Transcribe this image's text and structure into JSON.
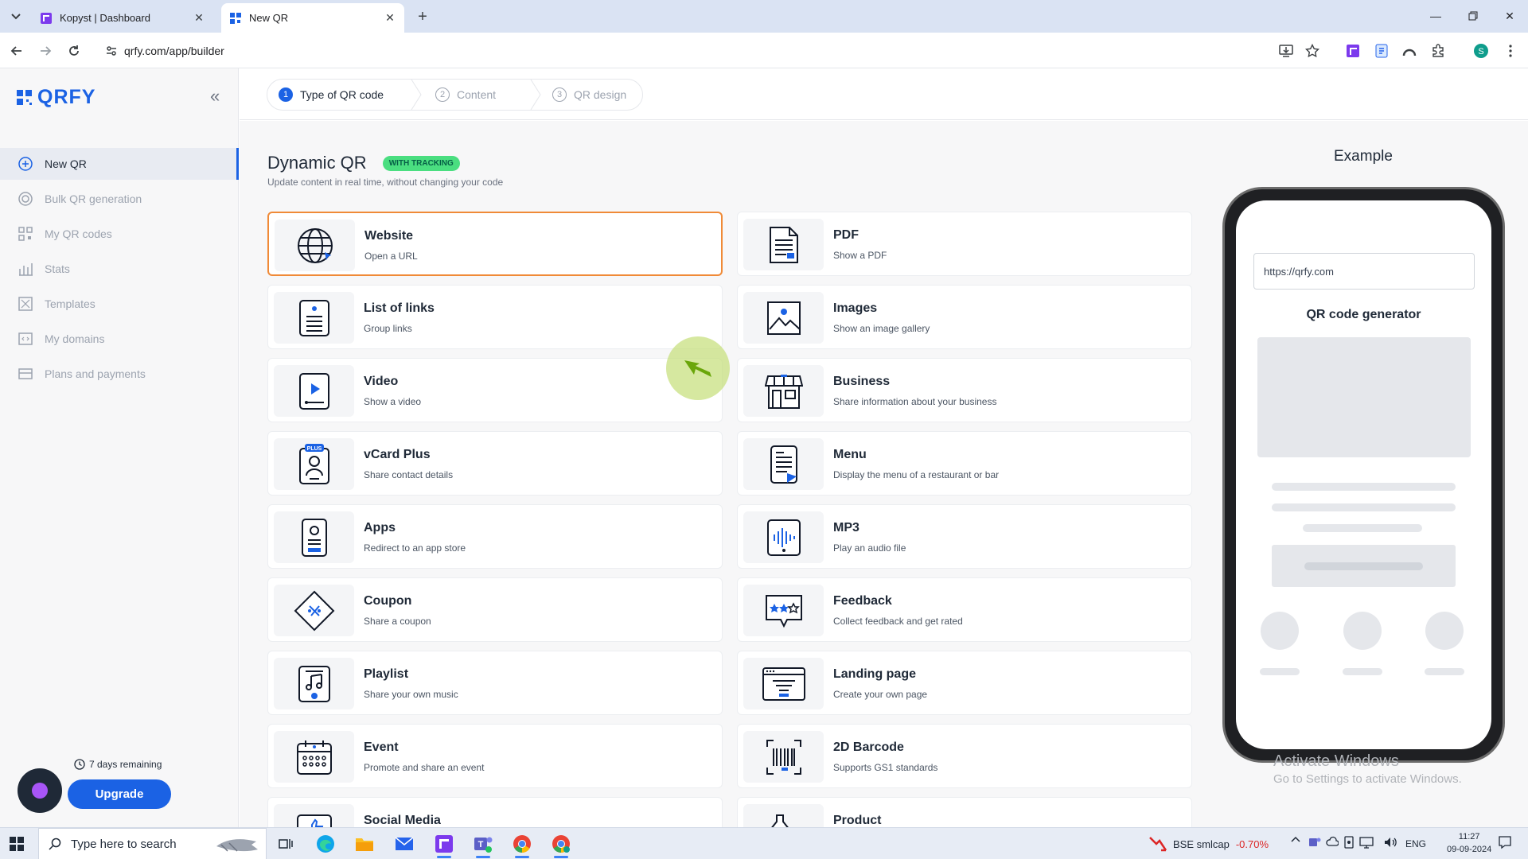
{
  "browser": {
    "tabs": [
      {
        "title": "Kopyst | Dashboard",
        "active": false
      },
      {
        "title": "New QR",
        "active": true
      }
    ],
    "url": "qrfy.com/app/builder"
  },
  "sidebar": {
    "logo": "QRFY",
    "items": [
      {
        "label": "New QR",
        "icon": "plus-circle-icon",
        "active": true
      },
      {
        "label": "Bulk QR generation",
        "icon": "target-icon",
        "active": false
      },
      {
        "label": "My QR codes",
        "icon": "qr-grid-icon",
        "active": false
      },
      {
        "label": "Stats",
        "icon": "bar-chart-icon",
        "active": false
      },
      {
        "label": "Templates",
        "icon": "template-icon",
        "active": false
      },
      {
        "label": "My domains",
        "icon": "domain-icon",
        "active": false
      },
      {
        "label": "Plans and payments",
        "icon": "card-icon",
        "active": false
      }
    ],
    "trial": "7 days remaining",
    "upgrade": "Upgrade"
  },
  "steps": [
    {
      "num": "1",
      "label": "Type of QR code",
      "active": true
    },
    {
      "num": "2",
      "label": "Content",
      "active": false
    },
    {
      "num": "3",
      "label": "QR design",
      "active": false
    }
  ],
  "heading": {
    "title": "Dynamic QR",
    "badge": "WITH TRACKING",
    "subtitle": "Update content in real time, without changing your code"
  },
  "cards": [
    {
      "title": "Website",
      "desc": "Open a URL",
      "icon": "globe-icon",
      "selected": true
    },
    {
      "title": "PDF",
      "desc": "Show a PDF",
      "icon": "pdf-icon"
    },
    {
      "title": "List of links",
      "desc": "Group links",
      "icon": "links-list-icon"
    },
    {
      "title": "Images",
      "desc": "Show an image gallery",
      "icon": "image-icon"
    },
    {
      "title": "Video",
      "desc": "Show a video",
      "icon": "video-icon"
    },
    {
      "title": "Business",
      "desc": "Share information about your business",
      "icon": "store-icon"
    },
    {
      "title": "vCard Plus",
      "desc": "Share contact details",
      "icon": "vcard-icon",
      "tag": "PLUS"
    },
    {
      "title": "Menu",
      "desc": "Display the menu of a restaurant or bar",
      "icon": "menu-icon"
    },
    {
      "title": "Apps",
      "desc": "Redirect to an app store",
      "icon": "app-icon"
    },
    {
      "title": "MP3",
      "desc": "Play an audio file",
      "icon": "audio-icon"
    },
    {
      "title": "Coupon",
      "desc": "Share a coupon",
      "icon": "coupon-icon"
    },
    {
      "title": "Feedback",
      "desc": "Collect feedback and get rated",
      "icon": "feedback-icon"
    },
    {
      "title": "Playlist",
      "desc": "Share your own music",
      "icon": "playlist-icon"
    },
    {
      "title": "Landing page",
      "desc": "Create your own page",
      "icon": "landing-page-icon"
    },
    {
      "title": "Event",
      "desc": "Promote and share an event",
      "icon": "calendar-icon"
    },
    {
      "title": "2D Barcode",
      "desc": "Supports GS1 standards",
      "icon": "barcode-icon"
    },
    {
      "title": "Social Media",
      "desc": "",
      "icon": "social-icon"
    },
    {
      "title": "Product",
      "desc": "",
      "icon": "product-icon"
    }
  ],
  "preview": {
    "title": "Example",
    "url": "https://qrfy.com",
    "heading": "QR code generator"
  },
  "watermark": {
    "line1": "Activate Windows",
    "line2": "Go to Settings to activate Windows."
  },
  "taskbar": {
    "search_placeholder": "Type here to search",
    "stock_name": "BSE smlcap",
    "stock_change": "-0.70%",
    "lang": "ENG",
    "time": "11:27",
    "date": "09-09-2024"
  },
  "colors": {
    "accent": "#1b62e4",
    "selected_border": "#f08a37",
    "badge": "#4ade80"
  }
}
